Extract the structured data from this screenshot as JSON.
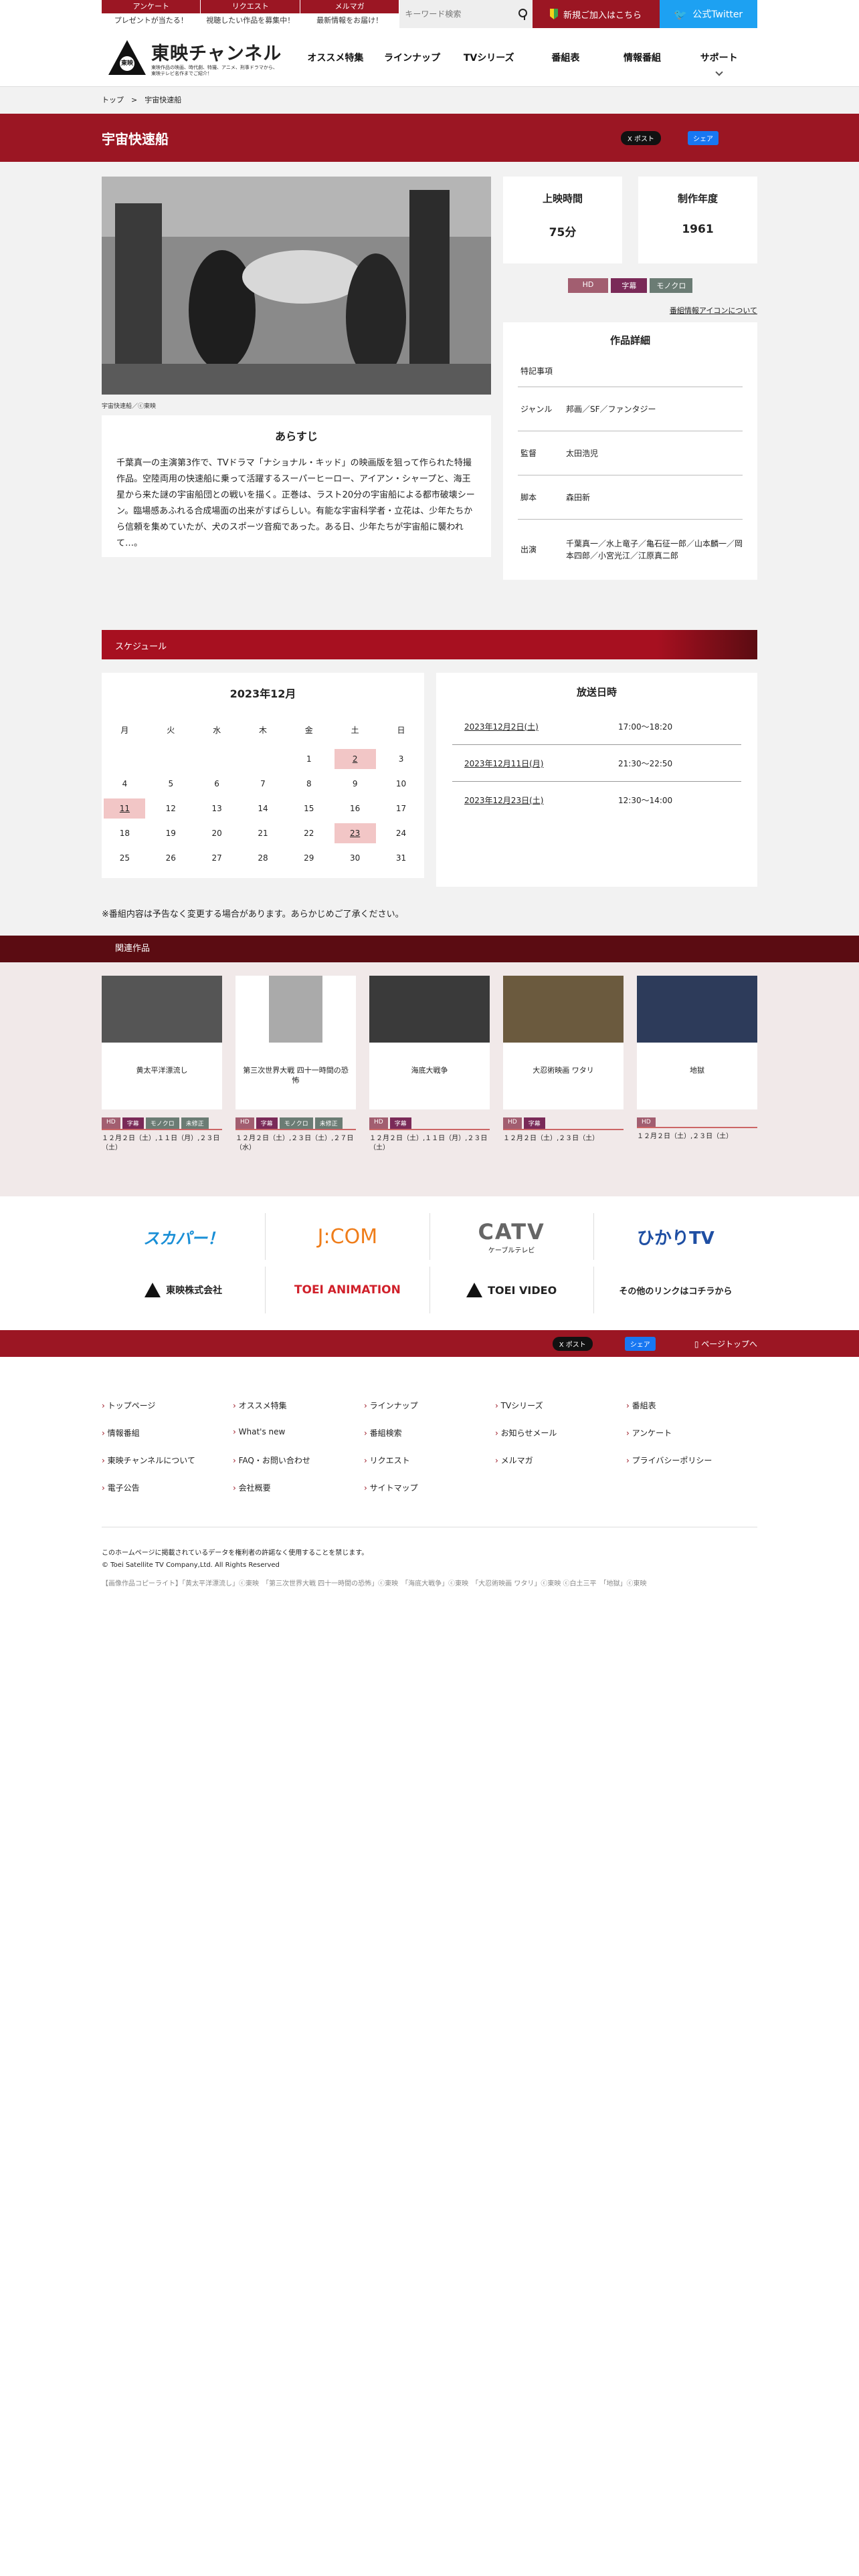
{
  "top_links": [
    {
      "label": "アンケート",
      "sub": "プレゼントが当たる！"
    },
    {
      "label": "リクエスト",
      "sub": "視聴したい作品を募集中！"
    },
    {
      "label": "メルマガ",
      "sub": "最新情報をお届け！"
    }
  ],
  "search": {
    "placeholder": "キーワード検索"
  },
  "join_label": "新規ご加入はこちら",
  "twitter_label": "公式Twitter",
  "logo": {
    "name": "東映チャンネル",
    "mark": "東映",
    "tagline": "東映作品の映画、時代劇、特撮、アニメ、刑事ドラマから、東映テレビ名作までご紹介！"
  },
  "nav": [
    "オススメ特集",
    "ラインナップ",
    "TVシリーズ",
    "番組表",
    "情報番組",
    "サポート"
  ],
  "breadcrumb": {
    "home": "トップ",
    "sep": ">",
    "current": "宇宙快速船"
  },
  "title": "宇宙快速船",
  "share": {
    "tw": "X ポスト",
    "fb": "シェア"
  },
  "still_caption": "宇宙快速船／ⓒ東映",
  "synopsis": {
    "heading": "あらすじ",
    "text": "千葉真一の主演第3作で、TVドラマ「ナショナル・キッド」の映画版を狙って作られた特撮作品。空陸両用の快速船に乗って活躍するスーパーヒーロー、アイアン・シャープと、海王星から来た謎の宇宙船団との戦いを描く。正巻は、ラスト20分の宇宙船による都市破壊シーン。臨場感あふれる合成場面の出来がすばらしい。有能な宇宙科学者・立花は、少年たちから信頼を集めていたが、犬のスポーツ音痴であった。ある日、少年たちが宇宙船に襲われて…。"
  },
  "stats": [
    {
      "label": "上映時間",
      "value": "75分"
    },
    {
      "label": "制作年度",
      "value": "1961"
    }
  ],
  "tags": [
    "HD",
    "字幕",
    "モノクロ"
  ],
  "icon_link": "番組情報アイコンについて",
  "details": {
    "heading": "作品詳細",
    "rows": [
      {
        "k": "特記事項",
        "v": ""
      },
      {
        "k": "ジャンル",
        "v": "邦画／SF／ファンタジー"
      },
      {
        "k": "監督",
        "v": "太田浩児"
      },
      {
        "k": "脚本",
        "v": "森田新"
      },
      {
        "k": "出演",
        "v": "千葉真一／水上竜子／亀石征一郎／山本麟一／岡本四郎／小宮光江／江原真二郎"
      }
    ]
  },
  "schedule": {
    "bar": "スケジュール",
    "month": "2023年12月",
    "weekdays": [
      "月",
      "火",
      "水",
      "木",
      "金",
      "土",
      "日"
    ],
    "weeks": [
      [
        "",
        "",
        "",
        "",
        "1",
        "2",
        "3"
      ],
      [
        "4",
        "5",
        "6",
        "7",
        "8",
        "9",
        "10"
      ],
      [
        "11",
        "12",
        "13",
        "14",
        "15",
        "16",
        "17"
      ],
      [
        "18",
        "19",
        "20",
        "21",
        "22",
        "23",
        "24"
      ],
      [
        "25",
        "26",
        "27",
        "28",
        "29",
        "30",
        "31"
      ]
    ],
    "highlights": [
      "2",
      "11",
      "23"
    ],
    "air_heading": "放送日時",
    "air": [
      {
        "d": "2023年12月2日(土)",
        "t": "17:00〜18:20"
      },
      {
        "d": "2023年12月11日(月)",
        "t": "21:30〜22:50"
      },
      {
        "d": "2023年12月23日(土)",
        "t": "12:30〜14:00"
      }
    ],
    "note": "※番組内容は予告なく変更する場合があります。あらかじめご了承ください。"
  },
  "related": {
    "bar": "関連作品",
    "items": [
      {
        "name": "黄太平洋漂流し",
        "tags": [
          "HD",
          "字幕",
          "モノクロ",
          "未修正"
        ],
        "dates": "１２月２日（土）,１１日（月）,２３日（土）"
      },
      {
        "name": "第三次世界大戦 四十一時間の恐怖",
        "tags": [
          "HD",
          "字幕",
          "モノクロ",
          "未修正"
        ],
        "dates": "１２月２日（土）,２３日（土）,２７日（水）"
      },
      {
        "name": "海底大戦争",
        "tags": [
          "HD",
          "字幕"
        ],
        "dates": "１２月２日（土）,１１日（月）,２３日（土）"
      },
      {
        "name": "大忍術映画 ワタリ",
        "tags": [
          "HD",
          "字幕"
        ],
        "dates": "１２月２日（土）,２３日（土）"
      },
      {
        "name": "地獄",
        "tags": [
          "HD"
        ],
        "dates": "１２月２日（土）,２３日（土）"
      }
    ]
  },
  "partners": [
    "スカパー！",
    "J:COM",
    "CATV",
    "ひかりTV",
    "東映株式会社",
    "TOEI ANIMATION",
    "TOEI VIDEO",
    "その他のリンクはコチラから"
  ],
  "catv_sub": "ケーブルテレビ",
  "pagetop": "ページトップへ",
  "footer_links": [
    "トップページ",
    "オススメ特集",
    "ラインナップ",
    "TVシリーズ",
    "番組表",
    "情報番組",
    "What's new",
    "番組検索",
    "お知らせメール",
    "アンケート",
    "東映チャンネルについて",
    "FAQ・お問い合わせ",
    "リクエスト",
    "メルマガ",
    "プライバシーポリシー",
    "電子公告",
    "会社概要",
    "サイトマップ"
  ],
  "copyright": [
    "このホームページに掲載されているデータを権利者の許諾なく使用することを禁じます。",
    "© Toei Satellite TV Company,Ltd. All Rights Reserved"
  ],
  "credits": "【画像作品コピーライト】「黄太平洋漂流し」ⓒ東映　「第三次世界大戦 四十一時間の恐怖」ⓒ東映　「海底大戦争」ⓒ東映　「大忍術映画 ワタリ」ⓒ東映 ⓒ白土三平　「地獄」ⓒ東映"
}
